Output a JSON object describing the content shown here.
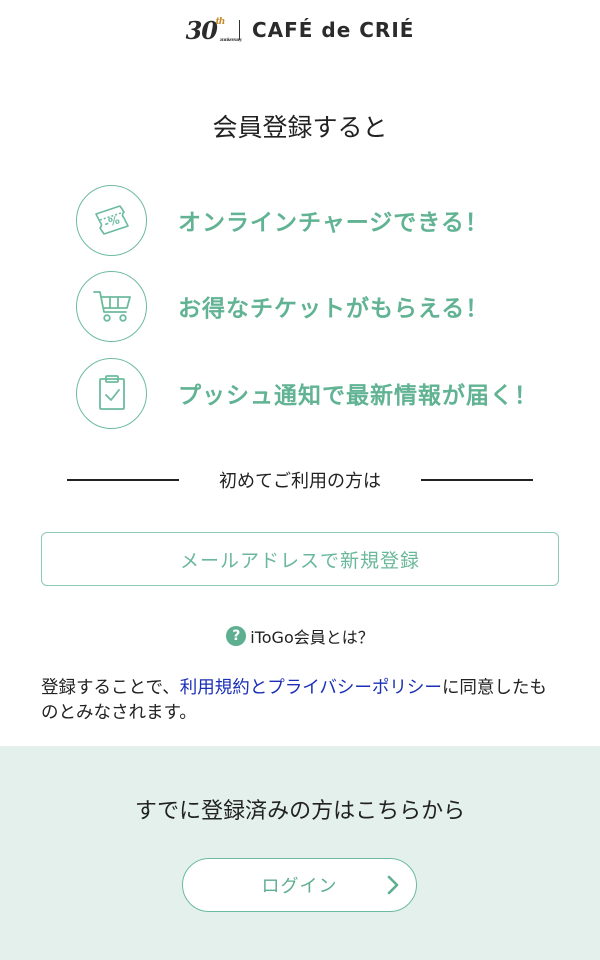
{
  "header": {
    "anniversary_number": "30",
    "anniversary_suffix": "th",
    "anniversary_word": "anniversary",
    "brand": "CAFÉ de CRIÉ"
  },
  "intro": {
    "heading": "会員登録すると"
  },
  "features": [
    {
      "icon": "coupon-icon",
      "text": "オンラインチャージできる！"
    },
    {
      "icon": "cart-icon",
      "text": "お得なチケットがもらえる！"
    },
    {
      "icon": "clipboard-icon",
      "text": "プッシュ通知で最新情報が届く！"
    }
  ],
  "first_time": {
    "label": "初めてご利用の方は"
  },
  "register_button": {
    "label": "メールアドレスで新規登録"
  },
  "help": {
    "icon": "question-icon",
    "icon_glyph": "?",
    "text": "iToGo会員とは？"
  },
  "terms": {
    "before": "登録することで、",
    "link": "利用規約とプライバシーポリシー",
    "after": "に同意したものとみなされます。"
  },
  "login": {
    "title": "すでに登録済みの方はこちらから",
    "button_label": "ログイン",
    "button_icon": "chevron-right-icon"
  },
  "colors": {
    "accent": "#61b394",
    "link": "#1a2fb8",
    "panel_bg": "#e4f0ec"
  }
}
